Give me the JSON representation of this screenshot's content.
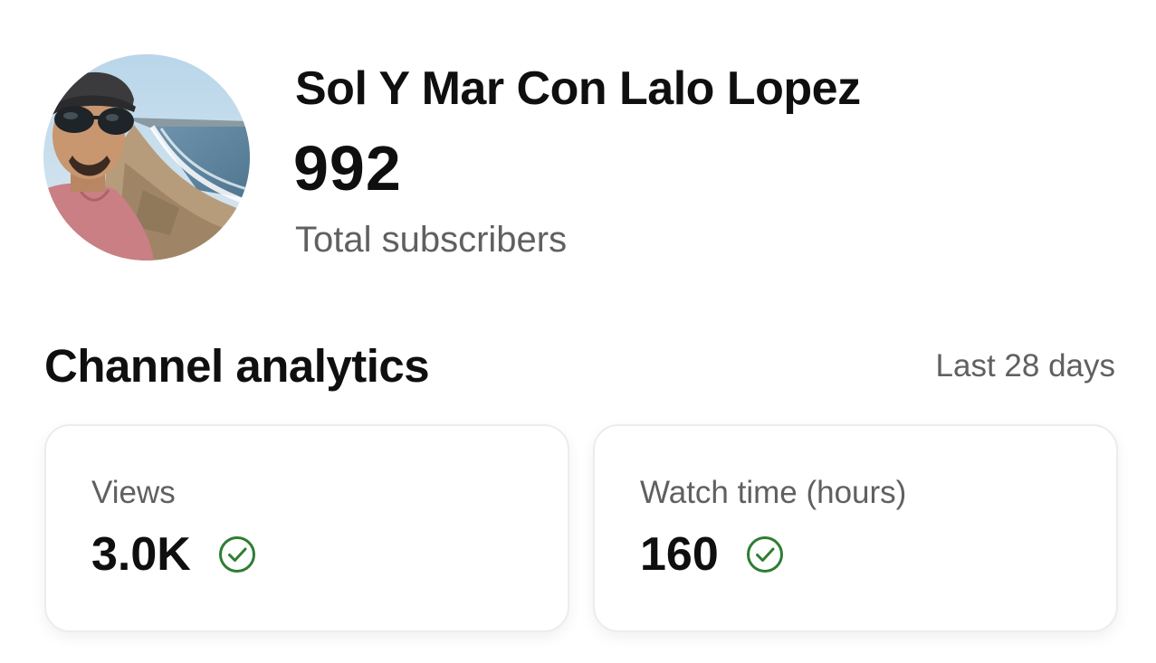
{
  "channel": {
    "name": "Sol Y Mar Con Lalo Lopez",
    "subscriber_count": "992",
    "subscriber_label": "Total subscribers",
    "avatar_icon": "profile-photo"
  },
  "analytics": {
    "title": "Channel analytics",
    "period": "Last 28 days",
    "cards": [
      {
        "label": "Views",
        "value": "3.0K",
        "status_icon": "check-circle-icon"
      },
      {
        "label": "Watch time (hours)",
        "value": "160",
        "status_icon": "check-circle-icon"
      }
    ]
  },
  "colors": {
    "text_primary": "#0f0f0f",
    "text_secondary": "#606060",
    "check_green": "#2e7d32",
    "card_border": "#ececec"
  }
}
